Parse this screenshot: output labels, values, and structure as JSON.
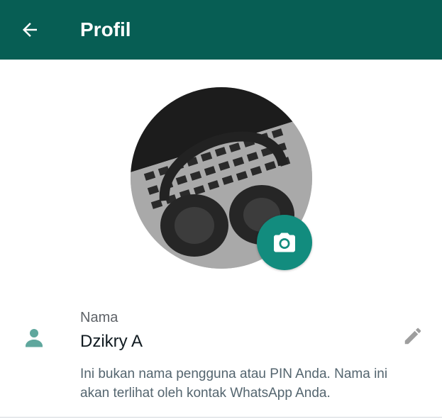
{
  "header": {
    "title": "Profil",
    "back_icon": "arrow-left-icon",
    "background_color": "#075e54"
  },
  "profile_photo": {
    "camera_icon": "camera-icon",
    "camera_button_color": "#128c7e"
  },
  "name_section": {
    "icon": "person-icon",
    "label": "Nama",
    "value": "Dzikry A",
    "edit_icon": "pencil-icon",
    "hint": "Ini bukan nama pengguna atau PIN Anda. Nama ini akan terlihat oleh kontak WhatsApp Anda."
  }
}
